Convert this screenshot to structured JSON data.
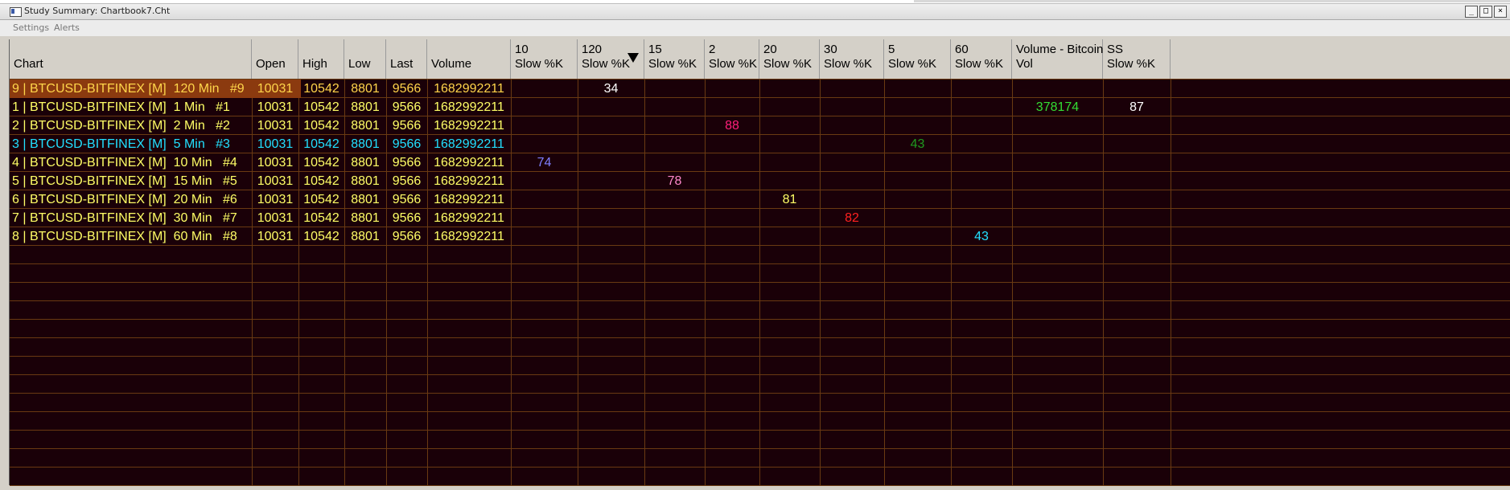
{
  "window": {
    "title": "Study Summary: Chartbook7.Cht",
    "buttons": [
      "_",
      "□",
      "×"
    ]
  },
  "menu": [
    "Settings",
    "Alerts"
  ],
  "columns": [
    {
      "key": "chart",
      "l1": "",
      "l2": "Chart"
    },
    {
      "key": "open",
      "l1": "",
      "l2": "Open"
    },
    {
      "key": "high",
      "l1": "",
      "l2": "High"
    },
    {
      "key": "low",
      "l1": "",
      "l2": "Low"
    },
    {
      "key": "last",
      "l1": "",
      "l2": "Last"
    },
    {
      "key": "volume",
      "l1": "",
      "l2": "Volume"
    },
    {
      "key": "s10",
      "l1": "10",
      "l2": "Slow %K"
    },
    {
      "key": "s120",
      "l1": "120",
      "l2": "Slow %K",
      "sorted": "desc"
    },
    {
      "key": "s15",
      "l1": "15",
      "l2": "Slow %K"
    },
    {
      "key": "s2",
      "l1": "2",
      "l2": "Slow %K"
    },
    {
      "key": "s20",
      "l1": "20",
      "l2": "Slow %K"
    },
    {
      "key": "s30",
      "l1": "30",
      "l2": "Slow %K"
    },
    {
      "key": "s5",
      "l1": "5",
      "l2": "Slow %K"
    },
    {
      "key": "s60",
      "l1": "60",
      "l2": "Slow %K"
    },
    {
      "key": "vol",
      "l1": "Volume - Bitcoin",
      "l2": "Vol"
    },
    {
      "key": "ss",
      "l1": "SS",
      "l2": "Slow %K"
    }
  ],
  "rows": [
    {
      "chart": "9 | BTCUSD-BITFINEX [M]  120 Min   #9",
      "open": "10031",
      "high": "10542",
      "low": "8801",
      "last": "9566",
      "volume": "1682992211",
      "color": "#ffd54a",
      "selected": true,
      "study": {
        "col": "s120",
        "value": "34",
        "color": "#ffffff"
      }
    },
    {
      "chart": "1 | BTCUSD-BITFINEX [M]  1 Min   #1",
      "open": "10031",
      "high": "10542",
      "low": "8801",
      "last": "9566",
      "volume": "1682992211",
      "color": "#ffff66",
      "extra": [
        {
          "col": "vol",
          "value": "378174",
          "color": "#33dd33"
        },
        {
          "col": "ss",
          "value": "87",
          "color": "#ffffff"
        }
      ]
    },
    {
      "chart": "2 | BTCUSD-BITFINEX [M]  2 Min   #2",
      "open": "10031",
      "high": "10542",
      "low": "8801",
      "last": "9566",
      "volume": "1682992211",
      "color": "#ffff66",
      "study": {
        "col": "s2",
        "value": "88",
        "color": "#ff1f7a"
      }
    },
    {
      "chart": "3 | BTCUSD-BITFINEX [M]  5 Min   #3",
      "open": "10031",
      "high": "10542",
      "low": "8801",
      "last": "9566",
      "volume": "1682992211",
      "color": "#22e0ff",
      "study": {
        "col": "s5",
        "value": "43",
        "color": "#1f9a1f"
      }
    },
    {
      "chart": "4 | BTCUSD-BITFINEX [M]  10 Min   #4",
      "open": "10031",
      "high": "10542",
      "low": "8801",
      "last": "9566",
      "volume": "1682992211",
      "color": "#ffff66",
      "study": {
        "col": "s10",
        "value": "74",
        "color": "#7f7fff"
      }
    },
    {
      "chart": "5 | BTCUSD-BITFINEX [M]  15 Min   #5",
      "open": "10031",
      "high": "10542",
      "low": "8801",
      "last": "9566",
      "volume": "1682992211",
      "color": "#ffff66",
      "study": {
        "col": "s15",
        "value": "78",
        "color": "#ff88cc"
      }
    },
    {
      "chart": "6 | BTCUSD-BITFINEX [M]  20 Min   #6",
      "open": "10031",
      "high": "10542",
      "low": "8801",
      "last": "9566",
      "volume": "1682992211",
      "color": "#ffff66",
      "study": {
        "col": "s20",
        "value": "81",
        "color": "#ffff66"
      }
    },
    {
      "chart": "7 | BTCUSD-BITFINEX [M]  30 Min   #7",
      "open": "10031",
      "high": "10542",
      "low": "8801",
      "last": "9566",
      "volume": "1682992211",
      "color": "#ffff66",
      "study": {
        "col": "s30",
        "value": "82",
        "color": "#ff2020"
      }
    },
    {
      "chart": "8 | BTCUSD-BITFINEX [M]  60 Min   #8",
      "open": "10031",
      "high": "10542",
      "low": "8801",
      "last": "9566",
      "volume": "1682992211",
      "color": "#ffff66",
      "study": {
        "col": "s60",
        "value": "43",
        "color": "#22e0ff"
      }
    }
  ]
}
